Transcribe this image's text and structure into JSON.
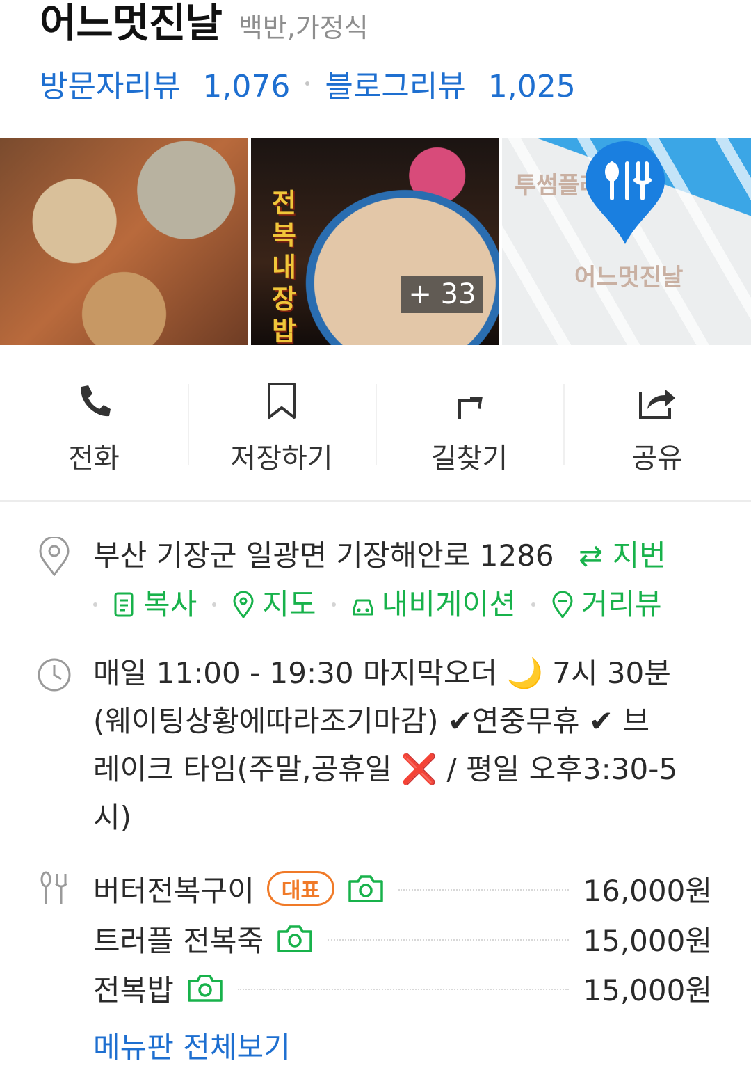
{
  "header": {
    "place_name": "어느멋진날",
    "category": "백반,가정식"
  },
  "reviews": {
    "visitor_label": "방문자리뷰",
    "visitor_count": "1,076",
    "blog_label": "블로그리뷰",
    "blog_count": "1,025"
  },
  "photos": {
    "photo2_text": "전복내장밥",
    "more_count": "+ 33",
    "map_label_top": "투썸플레",
    "map_label_place": "어느멋진날"
  },
  "actions": [
    {
      "label": "전화",
      "icon": "phone-icon"
    },
    {
      "label": "저장하기",
      "icon": "bookmark-icon"
    },
    {
      "label": "길찾기",
      "icon": "directions-icon"
    },
    {
      "label": "공유",
      "icon": "share-icon"
    }
  ],
  "address": {
    "text": "부산 기장군 일광면 기장해안로 1286",
    "lot_toggle": "⇄ 지번",
    "copy": "복사",
    "map": "지도",
    "navigation": "내비게이션",
    "street_view": "거리뷰"
  },
  "hours": {
    "line1": "매일 11:00 - 19:30 마지막오더 🌙 7시 30분",
    "line2": "(웨이팅상황에따라조기마감) ✔연중무휴 ✔ 브",
    "line3": "레이크 타임(주말,공휴일 ❌ / 평일 오후3:30-5",
    "line4": "시)"
  },
  "menu": {
    "items": [
      {
        "name": "버터전복구이",
        "badge": "대표",
        "price": "16,000원"
      },
      {
        "name": "트러플 전복죽",
        "badge": "",
        "price": "15,000원"
      },
      {
        "name": "전복밥",
        "badge": "",
        "price": "15,000원"
      }
    ],
    "view_all": "메뉴판 전체보기"
  },
  "colors": {
    "review_blue": "#1e6fd0",
    "action_green": "#18b24b",
    "badge_orange": "#f07a28",
    "pin_blue": "#1a7fe0"
  }
}
